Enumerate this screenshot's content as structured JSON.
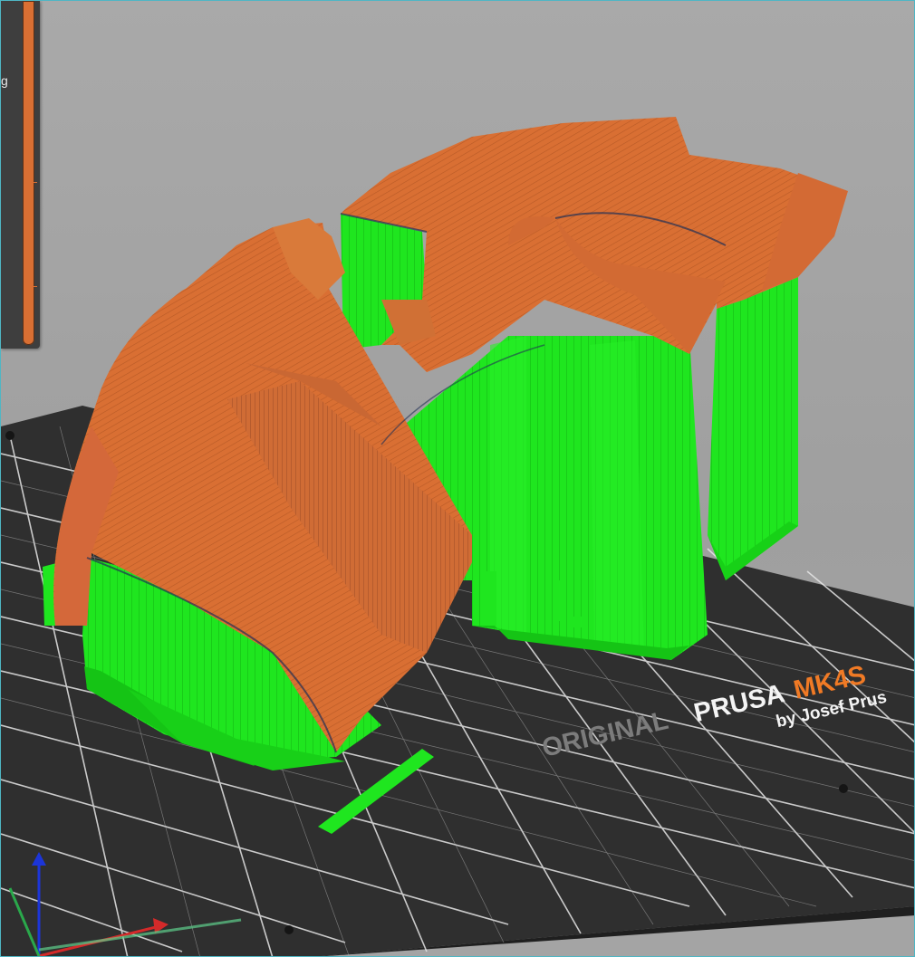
{
  "viewport": {
    "bed": {
      "brand_original": "ORIGINAL",
      "brand_prusa": "PRUSA",
      "brand_model": "MK4S",
      "brand_by": "by Josef Prus"
    },
    "legend": {
      "label_fragment": "g"
    },
    "colors": {
      "support": "#1fe61f",
      "model": "#d96f33",
      "bed": "#323232",
      "grid": "#e6e6e6",
      "model_accent": "#ff7a1a"
    },
    "icons": {
      "axes": "axes-gizmo-icon"
    }
  }
}
